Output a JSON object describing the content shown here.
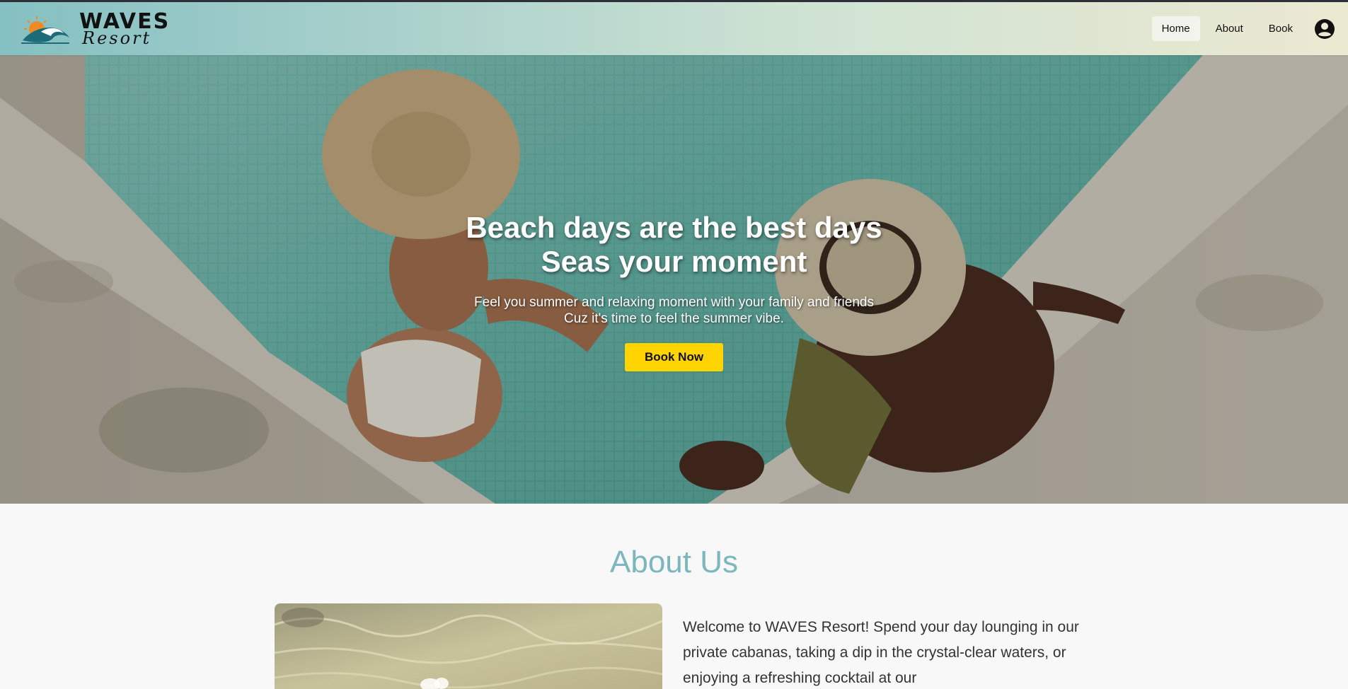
{
  "brand": {
    "title": "WAVES",
    "subtitle": "Resort"
  },
  "nav": {
    "items": [
      {
        "label": "Home",
        "active": true
      },
      {
        "label": "About",
        "active": false
      },
      {
        "label": "Book",
        "active": false
      }
    ],
    "account_icon": "account-circle-icon"
  },
  "hero": {
    "title_line1": "Beach days are the best days",
    "title_line2": "Seas your moment",
    "subtitle_line1": "Feel you summer and relaxing moment with your family and friends",
    "subtitle_line2": "Cuz it's time to feel the summer vibe.",
    "button_label": "Book Now",
    "button_color": "#ffd400"
  },
  "about": {
    "title": "About Us",
    "title_color": "#7db6bd",
    "text": "Welcome to WAVES Resort! Spend your day lounging in our private cabanas, taking a dip in the crystal-clear waters, or enjoying a refreshing cocktail at our"
  }
}
